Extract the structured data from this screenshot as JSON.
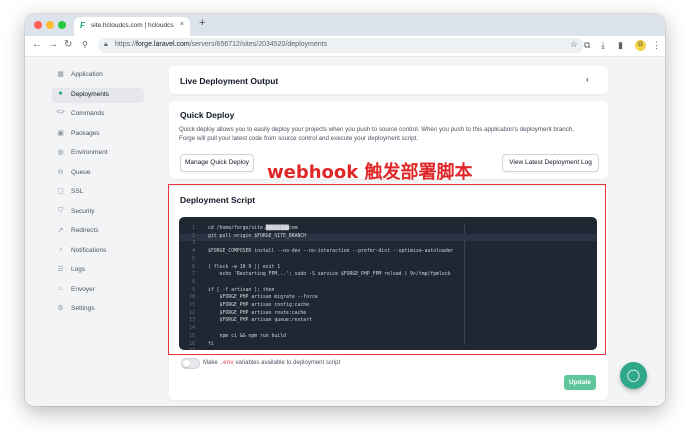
{
  "browser": {
    "tab_title": "site.hcloudcs.com | hcloudcs",
    "tab_close": "×",
    "new_tab": "+",
    "url_prefix": "https://",
    "url_host": "forge.laravel.com",
    "url_path": "/servers/656712/sites/2034520/deployments",
    "profile_initial": "G"
  },
  "sidebar": {
    "items": [
      {
        "label": "Application",
        "icon": "application-icon"
      },
      {
        "label": "Deployments",
        "icon": "deployments-icon",
        "active": true
      },
      {
        "label": "Commands",
        "icon": "commands-icon"
      },
      {
        "label": "Packages",
        "icon": "packages-icon"
      },
      {
        "label": "Environment",
        "icon": "environment-icon"
      },
      {
        "label": "Queue",
        "icon": "queue-icon"
      },
      {
        "label": "SSL",
        "icon": "ssl-icon"
      },
      {
        "label": "Security",
        "icon": "security-icon"
      },
      {
        "label": "Redirects",
        "icon": "redirects-icon"
      },
      {
        "label": "Notifications",
        "icon": "notifications-icon"
      },
      {
        "label": "Logs",
        "icon": "logs-icon"
      },
      {
        "label": "Envoyer",
        "icon": "envoyer-icon"
      },
      {
        "label": "Settings",
        "icon": "settings-icon"
      }
    ]
  },
  "live_output": {
    "title": "Live Deployment Output",
    "collapse": "‹"
  },
  "quick_deploy": {
    "title": "Quick Deploy",
    "desc_line1": "Quick deploy allows you to easily deploy your projects when you push to source control. When you push to this application's deployment branch,",
    "desc_line2": "Forge will pull your latest code from source control and execute your deployment script.",
    "manage_button": "Manage Quick Deploy",
    "view_log_button": "View Latest Deployment Log"
  },
  "annotation": {
    "text": "webhook 触发部署脚本",
    "color": "#e02727"
  },
  "deployment_script": {
    "title": "Deployment Script",
    "lines": [
      "cd /home/forge/site.████████com",
      "git pull origin $FORGE_SITE_BRANCH",
      "",
      "$FORGE_COMPOSER install --no-dev --no-interaction --prefer-dist --optimize-autoloader",
      "",
      "( flock -w 10 9 || exit 1",
      "    echo 'Restarting FPM...'; sudo -S service $FORGE_PHP_FPM reload ) 9>/tmp/fpmlock",
      "",
      "if [ -f artisan ]; then",
      "    $FORGE_PHP artisan migrate --force",
      "    $FORGE_PHP artisan config:cache",
      "    $FORGE_PHP artisan route:cache",
      "    $FORGE_PHP artisan queue:restart",
      "",
      "    npm ci && npm run build",
      "fi",
      ""
    ]
  },
  "env_toggle": {
    "prefix": "Make",
    "code": ".env",
    "suffix": "variables available to deployment script",
    "enabled": false
  },
  "update_button": "Update",
  "colors": {
    "accent": "#10a37f",
    "annotation_red": "#e3343a",
    "editor_bg": "#1f2733"
  }
}
